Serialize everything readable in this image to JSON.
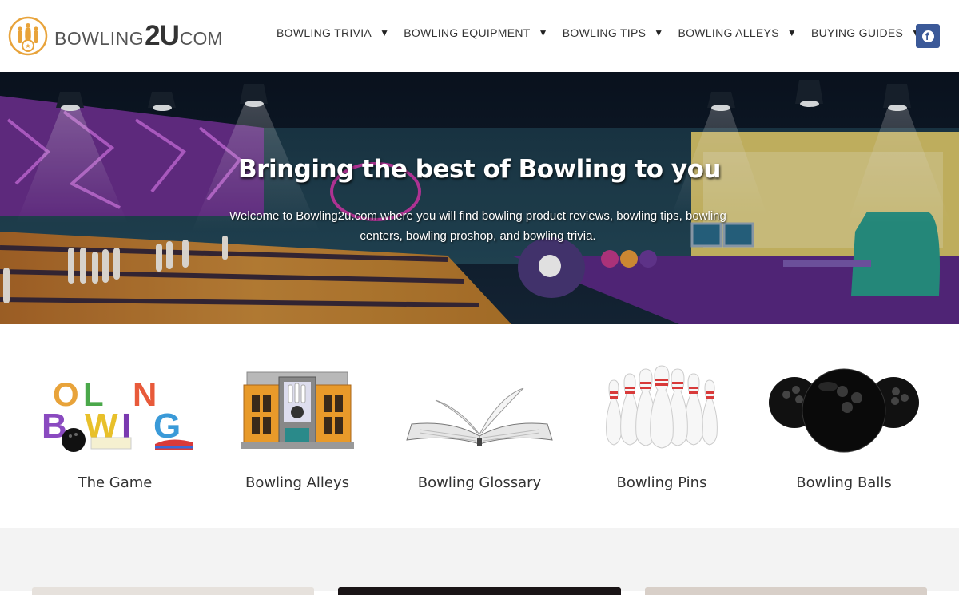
{
  "logo": {
    "part1": "BOWLING",
    "part2": "2U",
    "part3": "COM"
  },
  "nav": [
    {
      "label": "BOWLING TRIVIA",
      "caret": "▼"
    },
    {
      "label": "BOWLING EQUIPMENT",
      "caret": "▼"
    },
    {
      "label": "BOWLING TIPS",
      "caret": "▼"
    },
    {
      "label": "BOWLING ALLEYS",
      "caret": "▼"
    },
    {
      "label": "BUYING GUIDES",
      "caret": "▼"
    }
  ],
  "social": {
    "facebook_glyph": "f"
  },
  "hero": {
    "title": "Bringing the best of Bowling to you",
    "subtitle": "Welcome to Bowling2u.com where you will find bowling product reviews, bowling tips, bowling centers, bowling proshop, and bowling trivia."
  },
  "categories": [
    {
      "label": "The Game",
      "icon": "bowling-word-art-icon"
    },
    {
      "label": "Bowling Alleys",
      "icon": "bowling-alley-building-icon"
    },
    {
      "label": "Bowling Glossary",
      "icon": "open-book-icon"
    },
    {
      "label": "Bowling Pins",
      "icon": "bowling-pins-icon"
    },
    {
      "label": "Bowling Balls",
      "icon": "bowling-balls-icon"
    }
  ],
  "colors": {
    "accent": "#e8a33a",
    "facebook": "#3b5998",
    "text": "#333333",
    "bottom_bg": "#f3f3f3"
  }
}
